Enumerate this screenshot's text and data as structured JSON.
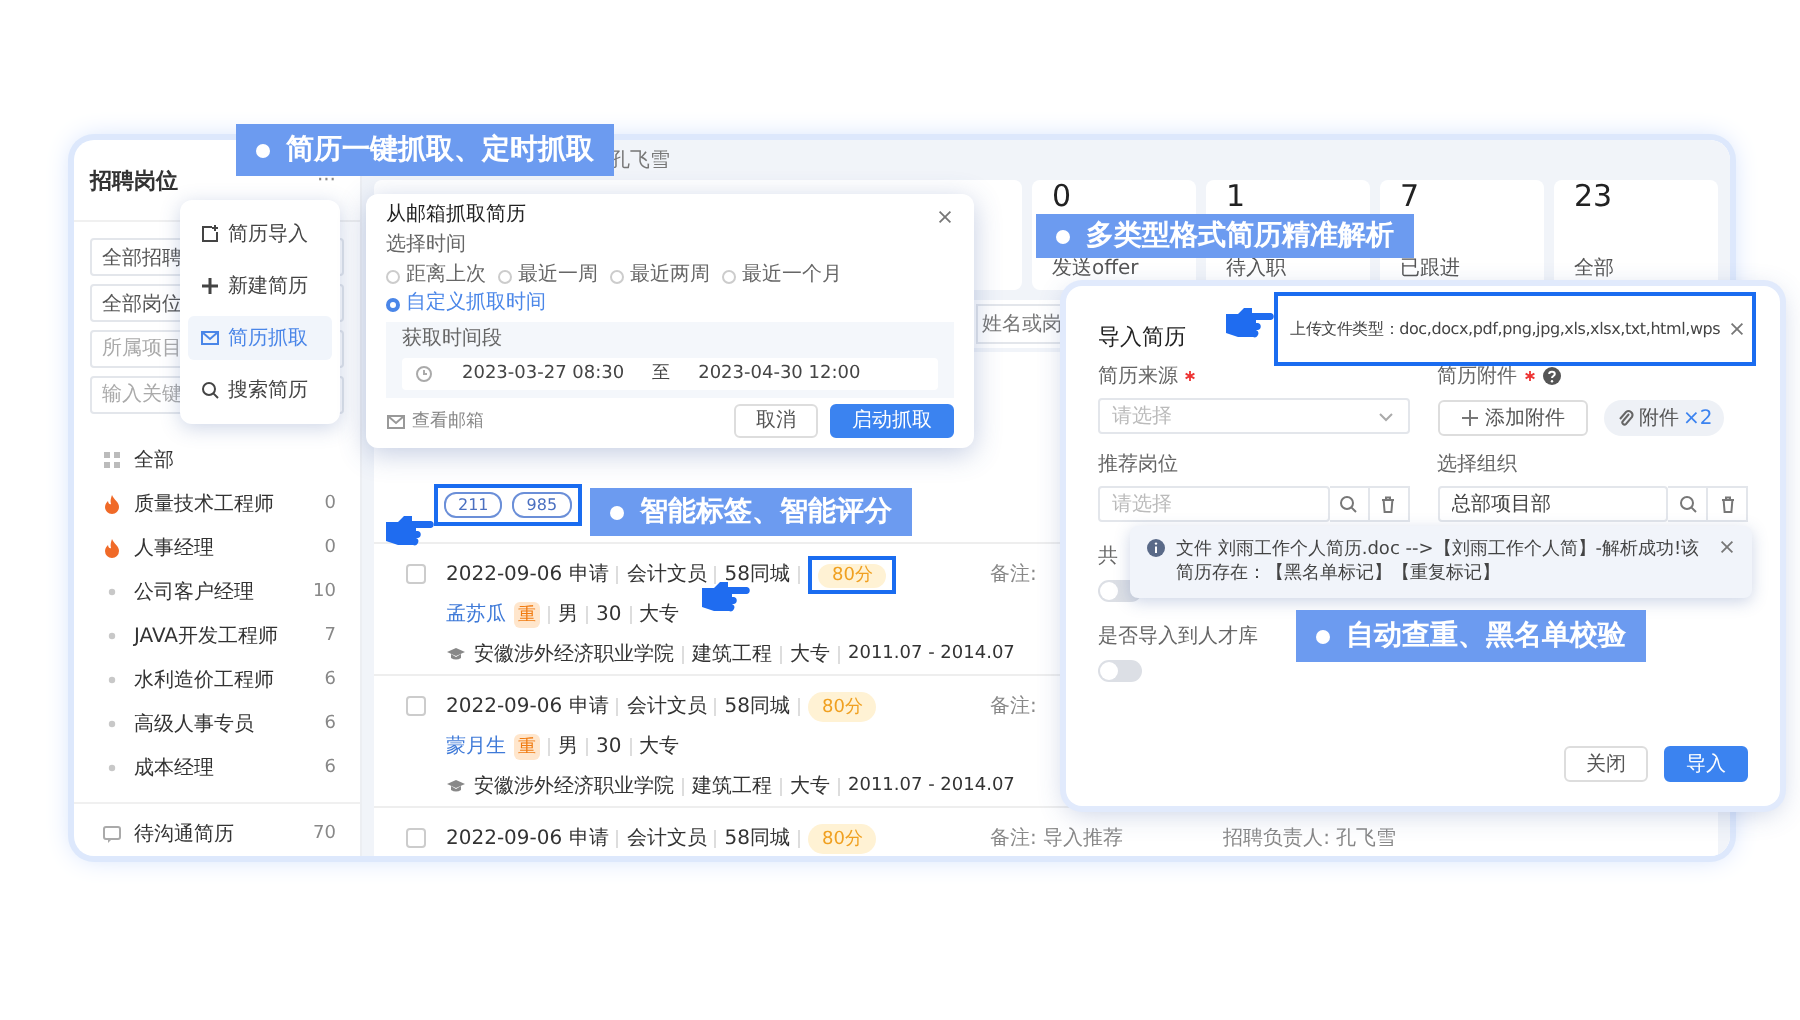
{
  "callouts": [
    {
      "text": "简历一键抓取、定时抓取"
    },
    {
      "text": "多类型格式简历精准解析"
    },
    {
      "text": "智能标签、智能评分"
    },
    {
      "text": "自动查重、黑名单校验"
    }
  ],
  "sidebar": {
    "title": "招聘岗位",
    "more": "···",
    "filters": [
      {
        "value": "全部招聘"
      },
      {
        "value": "全部岗位"
      },
      {
        "placeholder": "所属项目"
      },
      {
        "placeholder": "输入关键"
      }
    ],
    "items": [
      {
        "label": "全部",
        "kind": "all"
      },
      {
        "label": "质量技术工程师",
        "count": "0",
        "kind": "hot"
      },
      {
        "label": "人事经理",
        "count": "0",
        "kind": "hot"
      },
      {
        "label": "公司客户经理",
        "count": "10",
        "kind": "plain"
      },
      {
        "label": "JAVA开发工程师",
        "count": "7",
        "kind": "plain"
      },
      {
        "label": "水利造价工程师",
        "count": "6",
        "kind": "plain"
      },
      {
        "label": "高级人事专员",
        "count": "6",
        "kind": "plain"
      },
      {
        "label": "成本经理",
        "count": "6",
        "kind": "plain"
      }
    ],
    "footer": {
      "label": "待沟通简历",
      "count": "70"
    }
  },
  "menu": [
    {
      "label": "简历导入",
      "kind": "import",
      "selected": false
    },
    {
      "label": "新建简历",
      "kind": "new",
      "selected": false
    },
    {
      "label": "简历抓取",
      "kind": "grab",
      "selected": true
    },
    {
      "label": "搜索简历",
      "kind": "search",
      "selected": false
    }
  ],
  "header": {
    "owner": "孔飞雪"
  },
  "stats": [
    {
      "value": "0",
      "label": "发送offer"
    },
    {
      "value": "1",
      "label": "待入职"
    },
    {
      "value": "7",
      "label": "已跟进"
    },
    {
      "value": "23",
      "label": "全部"
    }
  ],
  "search": {
    "placeholder": "姓名或岗"
  },
  "tags": {
    "items": [
      "211",
      "985"
    ],
    "highlighted": true
  },
  "candidates": [
    {
      "checked": false,
      "applied": "2022-09-06 申请",
      "position": "会计文员",
      "source": "58同城",
      "score": "80分",
      "highlighted": true,
      "note": "备注:",
      "name": "孟苏瓜",
      "flag": "重",
      "gender": "男",
      "age": "30",
      "education": "大专",
      "school": "安徽涉外经济职业学院",
      "major": "建筑工程",
      "degree": "大专",
      "period": "2011.07 - 2014.07"
    },
    {
      "checked": false,
      "applied": "2022-09-06 申请",
      "position": "会计文员",
      "source": "58同城",
      "score": "80分",
      "highlighted": false,
      "note": "备注:",
      "name": "蒙月生",
      "flag": "重",
      "gender": "男",
      "age": "30",
      "education": "大专",
      "school": "安徽涉外经济职业学院",
      "major": "建筑工程",
      "degree": "大专",
      "period": "2011.07 - 2014.07"
    },
    {
      "checked": false,
      "applied": "2022-09-06 申请",
      "position": "会计文员",
      "source": "58同城",
      "score": "80分",
      "highlighted": false,
      "note": "备注: 导入推荐",
      "owner": "招聘负责人: 孔飞雪"
    }
  ],
  "email_dialog": {
    "title": "从邮箱抓取简历",
    "time_label": "选择时间",
    "options": [
      {
        "label": "距离上次",
        "selected": false
      },
      {
        "label": "最近一周",
        "selected": false
      },
      {
        "label": "最近两周",
        "selected": false
      },
      {
        "label": "最近一个月",
        "selected": false
      },
      {
        "label": "自定义抓取时间",
        "selected": true
      }
    ],
    "range_label": "获取时间段",
    "start": "2023-03-27 08:30",
    "separator": "至",
    "end": "2023-04-30 12:00",
    "mailbox_link": "查看邮箱",
    "buttons": [
      "取消",
      "启动抓取"
    ]
  },
  "import_dialog": {
    "title": "导入简历",
    "file_types": "上传文件类型：doc,docx,pdf,png,jpg,xls,xlsx,txt,html,wps",
    "fields": [
      {
        "label": "简历来源",
        "required": true,
        "kind": "select",
        "placeholder": "请选择"
      },
      {
        "label": "简历附件",
        "required": true,
        "help": true,
        "kind": "attach",
        "button": "添加附件",
        "chip": "附件",
        "chip_count": "×2"
      },
      {
        "label": "推荐岗位",
        "kind": "lookup",
        "placeholder": "请选择"
      },
      {
        "label": "选择组织",
        "kind": "lookup",
        "value": "总部项目部"
      }
    ],
    "notice": "文件 刘雨工作个人简历.doc -->【刘雨工作个人简】-解析成功!该简历存在：【黑名单标记】【重复标记】",
    "toggles": [
      {
        "label": "共",
        "on": false
      },
      {
        "label": "是否导入到人才库",
        "on": false
      }
    ],
    "buttons": [
      "关闭",
      "导入"
    ]
  }
}
